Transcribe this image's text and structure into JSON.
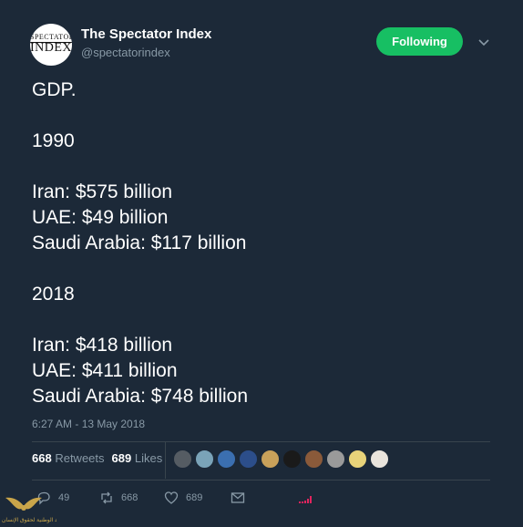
{
  "header": {
    "avatar_line1": "SPECTATOR",
    "avatar_line2": "INDEX",
    "display_name": "The Spectator Index",
    "handle": "@spectatorindex",
    "follow_label": "Following"
  },
  "tweet": {
    "text": "GDP.\n\n1990\n\nIran: $575 billion\nUAE: $49 billion\nSaudi Arabia: $117 billion\n\n2018\n\nIran: $418 billion\nUAE: $411 billion\nSaudi Arabia: $748 billion",
    "timestamp": "6:27 AM - 13 May 2018"
  },
  "stats": {
    "retweets_count": "668",
    "retweets_label": "Retweets",
    "likes_count": "689",
    "likes_label": "Likes"
  },
  "likers": [
    {
      "color": "#555c63"
    },
    {
      "color": "#7aa3b8"
    },
    {
      "color": "#3b6fb0"
    },
    {
      "color": "#2c4e8a"
    },
    {
      "color": "#c9a15a"
    },
    {
      "color": "#1a1a1a"
    },
    {
      "color": "#8a5a3a"
    },
    {
      "color": "#9a9a9a"
    },
    {
      "color": "#e8d37a"
    },
    {
      "color": "#e9e4dc"
    }
  ],
  "actions": {
    "reply_count": "49",
    "retweet_count": "668",
    "like_count": "689"
  },
  "watermark": {
    "text": "البلاد الوطنية لحقوق الإنسان"
  },
  "colors": {
    "background": "#1c2938",
    "accent_green": "#17bf63",
    "muted": "#8899a6",
    "analytics_red": "#e0245e"
  }
}
